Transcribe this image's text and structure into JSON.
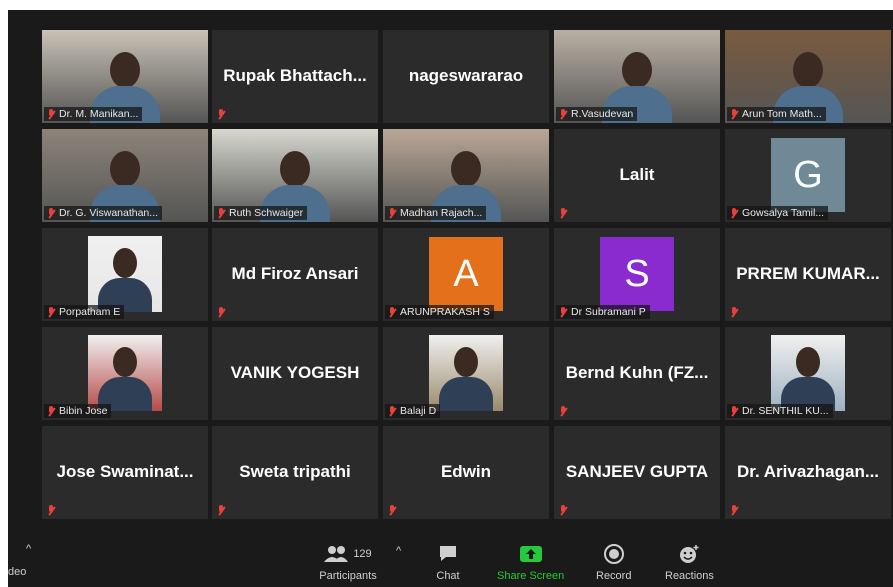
{
  "tiles": [
    {
      "name": "Dr. M. Manikan...",
      "kind": "photo",
      "bg": "#c9c2b6"
    },
    {
      "name": "Rupak  Bhattach...",
      "kind": "text"
    },
    {
      "name": "nageswararao",
      "kind": "text",
      "nolabel": true
    },
    {
      "name": "R.Vasudevan",
      "kind": "photo",
      "bg": "#b9b0a4"
    },
    {
      "name": "Arun Tom Math...",
      "kind": "photo",
      "bg": "#7a5a3e"
    },
    {
      "name": "Dr. G. Viswanathan...",
      "kind": "photo",
      "bg": "#8d8479"
    },
    {
      "name": "Ruth Schwaiger",
      "kind": "photo",
      "bg": "#d8d8d0",
      "active": true
    },
    {
      "name": "Madhan Rajach...",
      "kind": "photo",
      "bg": "#b9a795"
    },
    {
      "name": "Lalit",
      "kind": "text"
    },
    {
      "name": "Gowsalya Tamil...",
      "kind": "avatar",
      "letter": "G",
      "color": "#6f8a96"
    },
    {
      "name": "Porpatham E",
      "kind": "smallphoto",
      "bg": "#e6e6e6"
    },
    {
      "name": "Md Firoz Ansari",
      "kind": "text"
    },
    {
      "name": "ARUNPRAKASH S",
      "kind": "avatar",
      "letter": "A",
      "color": "#e5701b"
    },
    {
      "name": "Dr Subramani P",
      "kind": "avatar",
      "letter": "S",
      "color": "#8a2bd0"
    },
    {
      "name": "PRREM  KUMAR...",
      "kind": "text"
    },
    {
      "name": "Bibin Jose",
      "kind": "smallphoto",
      "bg": "#b54a48"
    },
    {
      "name": "VANIK YOGESH",
      "kind": "text",
      "nolabel": true
    },
    {
      "name": "Balaji D",
      "kind": "smallphoto",
      "bg": "#9a8a6a"
    },
    {
      "name": "Bernd  Kuhn  (FZ...",
      "kind": "text"
    },
    {
      "name": "Dr. SENTHIL KU...",
      "kind": "smallphoto",
      "bg": "#9fb2c0"
    },
    {
      "name": "Jose  Swaminat...",
      "kind": "text"
    },
    {
      "name": "Sweta tripathi",
      "kind": "text"
    },
    {
      "name": "Edwin",
      "kind": "text"
    },
    {
      "name": "SANJEEV GUPTA",
      "kind": "text"
    },
    {
      "name": "Dr.  Arivazhagan...",
      "kind": "text"
    }
  ],
  "toolbar": {
    "video_label": "deo",
    "participants_label": "Participants",
    "participants_count": "129",
    "chat_label": "Chat",
    "share_label": "Share Screen",
    "record_label": "Record",
    "reactions_label": "Reactions",
    "accent": "#25c93b"
  }
}
